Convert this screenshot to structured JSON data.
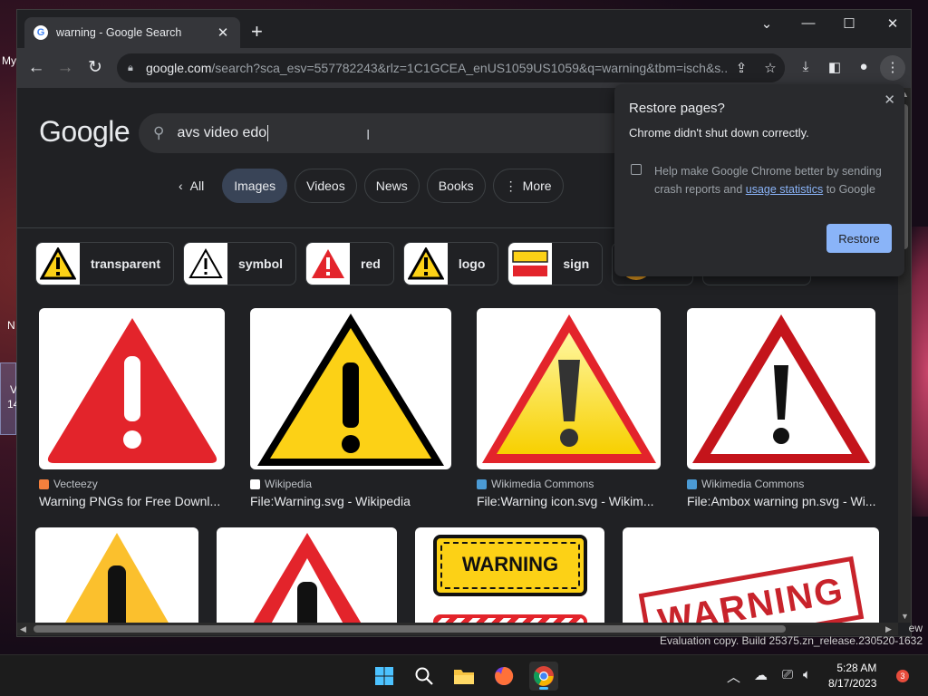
{
  "desktop": {
    "left_labels": [
      "My",
      "N",
      "V",
      "14"
    ]
  },
  "browser": {
    "tab": {
      "title": "warning - Google Search",
      "favicon": "G"
    },
    "window_controls": [
      "chevron-down-icon",
      "minimize-icon",
      "maximize-icon",
      "close-icon"
    ],
    "url_host": "google.com",
    "url_path": "/search?sca_esv=557782243&rlz=1C1GCEA_enUS1059US1059&q=warning&tbm=isch&s..."
  },
  "google": {
    "logo": "Google",
    "search_value": "avs video edo",
    "nav_back": "All",
    "tabs": [
      {
        "label": "Images",
        "active": true
      },
      {
        "label": "Videos",
        "active": false
      },
      {
        "label": "News",
        "active": false
      },
      {
        "label": "Books",
        "active": false
      },
      {
        "label": "More",
        "active": false
      }
    ],
    "refine_chips": [
      "transparent",
      "symbol",
      "red",
      "logo",
      "sign"
    ],
    "results": [
      {
        "source": "Vecteezy",
        "caption": "Warning PNGs for Free Downl...",
        "fav_color": "#f4803d"
      },
      {
        "source": "Wikipedia",
        "caption": "File:Warning.svg - Wikipedia",
        "fav_color": "#ffffff"
      },
      {
        "source": "Wikimedia Commons",
        "caption": "File:Warning icon.svg - Wikim...",
        "fav_color": "#4b9ad4"
      },
      {
        "source": "Wikimedia Commons",
        "caption": "File:Ambox warning pn.svg - Wi...",
        "fav_color": "#4b9ad4"
      }
    ],
    "banner_text": "WARNING",
    "stamp_text": "WARNING"
  },
  "popup": {
    "title": "Restore pages?",
    "message": "Chrome didn't shut down correctly.",
    "option_prefix": "Help make Google Chrome better by sending crash reports and ",
    "option_link": "usage statistics",
    "option_suffix": " to Google",
    "button": "Restore"
  },
  "watermark": {
    "line1": "ew",
    "line2": "Evaluation copy. Build 25375.zn_release.230520-1632"
  },
  "taskbar": {
    "time": "5:28 AM",
    "date": "8/17/2023",
    "notification_count": "3"
  },
  "colors": {
    "accent": "#8ab4f8",
    "warning_yellow": "#fcd116",
    "warning_red": "#e3242b"
  }
}
